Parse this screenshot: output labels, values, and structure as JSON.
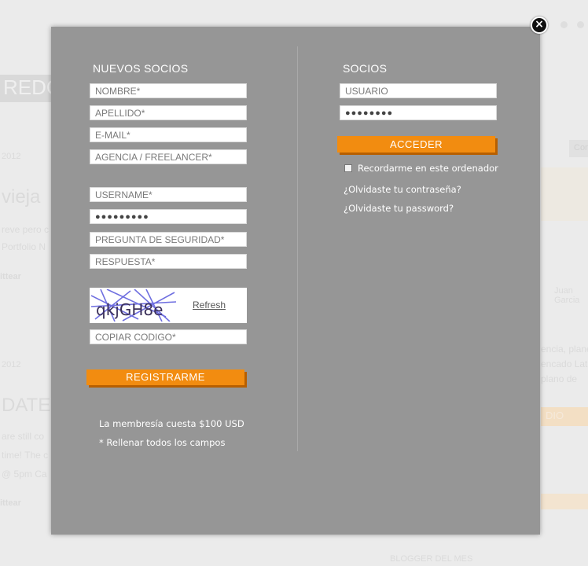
{
  "modal": {
    "close_glyph": "×",
    "left": {
      "heading": "NUEVOS SOCIOS",
      "fields": [
        {
          "name": "nombre-field",
          "placeholder": "NOMBRE*"
        },
        {
          "name": "apellido-field",
          "placeholder": "APELLIDO*"
        },
        {
          "name": "email-field",
          "placeholder": "E-MAIL*"
        },
        {
          "name": "agencia-field",
          "placeholder": "AGENCIA / FREELANCER*"
        },
        {
          "name": "username-field",
          "placeholder": "USERNAME*"
        },
        {
          "name": "password-field",
          "value": "●●●●●●●●●"
        },
        {
          "name": "pregunta-field",
          "placeholder": "PREGUNTA DE SEGURIDAD*"
        },
        {
          "name": "respuesta-field",
          "placeholder": "RESPUESTA*"
        }
      ],
      "captcha": {
        "text": "qkjGH8e",
        "refresh_label": "Refresh"
      },
      "copiar_codigo": "COPIAR CODIGO*",
      "register_label": "REGISTRARME",
      "membership_note": "La membresía cuesta $100 USD",
      "required_note": "* Rellenar todos los campos"
    },
    "right": {
      "heading": "SOCIOS",
      "usuario_placeholder": "USUARIO",
      "password_value": "●●●●●●●●",
      "login_label": "ACCEDER",
      "remember_label": "Recordarme en este ordenador",
      "forgot_contrasena": "¿Olvidaste tu contraseña?",
      "forgot_password": "¿Olvidaste tu password?"
    }
  },
  "background": {
    "texts": [
      "REDC",
      "2012",
      "vieja",
      "reve pero c",
      "Portfolio N",
      "ittear",
      "2012",
      "DATE V",
      "are still co",
      "time! The c",
      "@ 5pm  Ca",
      "ittear",
      "Con",
      "Juan",
      "Garcia",
      "encia, plane",
      "encado Lat",
      "plano de",
      "DIO",
      "BLOGGER DEL MES"
    ]
  },
  "colors": {
    "modal_bg": "#969696",
    "accent_orange": "#f28c10",
    "accent_shadow": "#b75f00"
  }
}
